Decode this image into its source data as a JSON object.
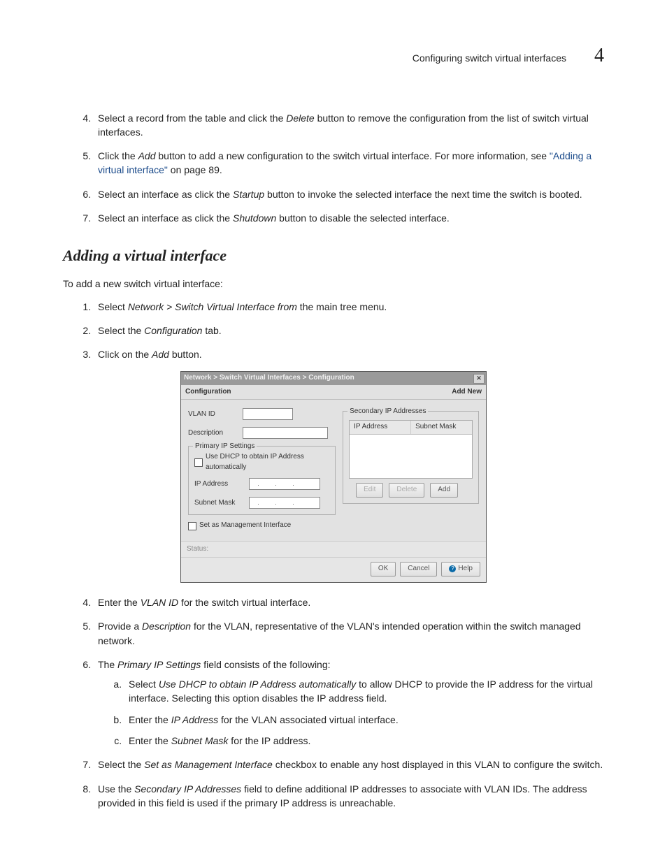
{
  "header": {
    "title": "Configuring switch virtual interfaces",
    "chapter": "4"
  },
  "steps_a": [
    {
      "pre": "Select a record from the table and click the ",
      "em": "Delete",
      "post": " button to remove the configuration from the list of switch virtual interfaces."
    },
    {
      "pre": "Click the ",
      "em": "Add",
      "post": " button to add a new configuration to the switch virtual interface. For more information, see ",
      "link": "\"Adding a virtual interface\"",
      "post2": " on page 89."
    },
    {
      "pre": "Select an interface as click the ",
      "em": "Startup",
      "post": " button to invoke the selected interface the next time the switch is booted."
    },
    {
      "pre": "Select an interface as click the ",
      "em": "Shutdown",
      "post": " button to disable the selected interface."
    }
  ],
  "section_title": "Adding a virtual interface",
  "intro": "To add a new switch virtual interface:",
  "steps_b": [
    {
      "pre": "Select ",
      "em": "Network > Switch Virtual Interface from",
      "post": " the main tree menu."
    },
    {
      "pre": "Select the ",
      "em": "Configuration",
      "post": " tab."
    },
    {
      "pre": "Click on the ",
      "em": "Add",
      "post": " button."
    }
  ],
  "dialog": {
    "breadcrumb": "Network > Switch Virtual Interfaces > Configuration",
    "tab": "Configuration",
    "mode": "Add New",
    "labels": {
      "vlan_id": "VLAN ID",
      "description": "Description",
      "primary_ip": "Primary IP Settings",
      "use_dhcp": "Use DHCP to obtain IP Address automatically",
      "ip_address": "IP Address",
      "subnet_mask": "Subnet Mask",
      "set_mgmt": "Set as Management Interface",
      "secondary": "Secondary IP Addresses",
      "col_ip": "IP Address",
      "col_mask": "Subnet Mask",
      "status": "Status:"
    },
    "buttons": {
      "edit": "Edit",
      "delete": "Delete",
      "add": "Add",
      "ok": "OK",
      "cancel": "Cancel",
      "help": "Help"
    }
  },
  "steps_c": [
    {
      "pre": "Enter the ",
      "em": "VLAN ID",
      "post": " for the switch virtual interface."
    },
    {
      "pre": "Provide a ",
      "em": "Description",
      "post": " for the VLAN, representative of the VLAN's intended operation within the switch managed network."
    },
    {
      "pre": "The ",
      "em": "Primary IP Settings",
      "post": " field consists of the following:",
      "sub": [
        {
          "pre": "Select ",
          "em": "Use DHCP to obtain IP Address automatically",
          "post": " to allow DHCP to provide the IP address for the virtual interface. Selecting this option disables the IP address field."
        },
        {
          "pre": "Enter the ",
          "em": "IP Address",
          "post": " for the VLAN associated virtual interface."
        },
        {
          "pre": "Enter the ",
          "em": "Subnet Mask",
          "post": " for the IP address."
        }
      ]
    },
    {
      "pre": "Select the ",
      "em": "Set as Management Interface",
      "post": " checkbox to enable any host displayed in this VLAN to configure the switch."
    },
    {
      "pre": "Use the ",
      "em": "Secondary IP Addresses",
      "post": " field to define additional IP addresses to associate with VLAN IDs. The address provided in this field is used if the primary IP address is unreachable."
    }
  ]
}
